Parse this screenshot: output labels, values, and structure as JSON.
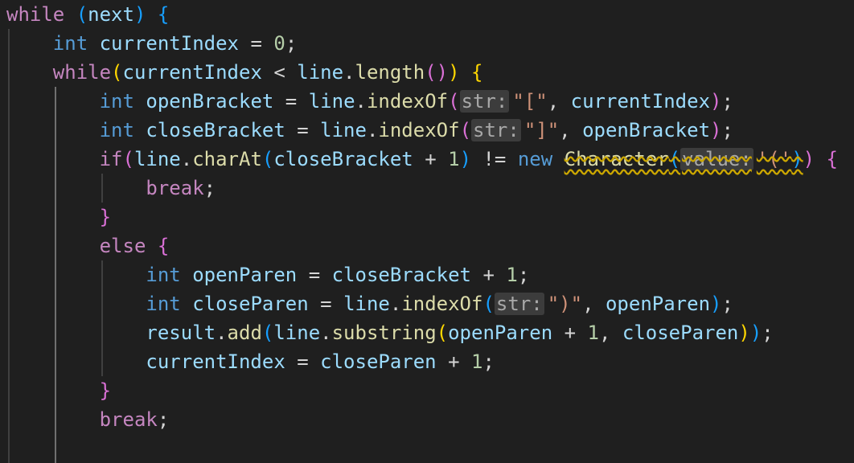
{
  "editor": {
    "language": "java",
    "colors": {
      "background": "#1f1f1f",
      "keyword": "#c586c0",
      "type": "#569cd6",
      "variable": "#9cdcfe",
      "function": "#dcdcaa",
      "number": "#b5cea8",
      "string": "#ce9178",
      "warning_squiggle": "#cca700",
      "bracket_level_1": "#ffd700",
      "bracket_level_2": "#da70d6",
      "bracket_level_3": "#179fff"
    },
    "lines": [
      {
        "indent": 0,
        "tokens": [
          {
            "t": "while",
            "c": "kw"
          },
          {
            "t": " "
          },
          {
            "t": "(",
            "c": "br3"
          },
          {
            "t": "next",
            "c": "var"
          },
          {
            "t": ")",
            "c": "br3"
          },
          {
            "t": " "
          },
          {
            "t": "{",
            "c": "br3"
          }
        ]
      },
      {
        "indent": 1,
        "tokens": [
          {
            "t": "int",
            "c": "type"
          },
          {
            "t": " "
          },
          {
            "t": "currentIndex",
            "c": "var"
          },
          {
            "t": " = "
          },
          {
            "t": "0",
            "c": "num"
          },
          {
            "t": ";"
          }
        ]
      },
      {
        "indent": 1,
        "tokens": [
          {
            "t": "while",
            "c": "kw"
          },
          {
            "t": "(",
            "c": "br1"
          },
          {
            "t": "currentIndex",
            "c": "var"
          },
          {
            "t": " < "
          },
          {
            "t": "line",
            "c": "var"
          },
          {
            "t": "."
          },
          {
            "t": "length",
            "c": "fn"
          },
          {
            "t": "()",
            "c": "br2"
          },
          {
            "t": ")",
            "c": "br1"
          },
          {
            "t": " "
          },
          {
            "t": "{",
            "c": "br1"
          }
        ]
      },
      {
        "indent": 2,
        "tokens": [
          {
            "t": "int",
            "c": "type"
          },
          {
            "t": " "
          },
          {
            "t": "openBracket",
            "c": "var"
          },
          {
            "t": " = "
          },
          {
            "t": "line",
            "c": "var"
          },
          {
            "t": "."
          },
          {
            "t": "indexOf",
            "c": "fn"
          },
          {
            "t": "(",
            "c": "br2"
          },
          {
            "t": "str:",
            "c": "hint"
          },
          {
            "t": "\"[\"",
            "c": "str"
          },
          {
            "t": ", "
          },
          {
            "t": "currentIndex",
            "c": "var"
          },
          {
            "t": ")",
            "c": "br2"
          },
          {
            "t": ";"
          }
        ]
      },
      {
        "indent": 2,
        "tokens": [
          {
            "t": "int",
            "c": "type"
          },
          {
            "t": " "
          },
          {
            "t": "closeBracket",
            "c": "var"
          },
          {
            "t": " = "
          },
          {
            "t": "line",
            "c": "var"
          },
          {
            "t": "."
          },
          {
            "t": "indexOf",
            "c": "fn"
          },
          {
            "t": "(",
            "c": "br2"
          },
          {
            "t": "str:",
            "c": "hint"
          },
          {
            "t": "\"]\"",
            "c": "str"
          },
          {
            "t": ", "
          },
          {
            "t": "openBracket",
            "c": "var"
          },
          {
            "t": ")",
            "c": "br2"
          },
          {
            "t": ";"
          }
        ]
      },
      {
        "indent": 2,
        "tokens": [
          {
            "t": "if",
            "c": "kw"
          },
          {
            "t": "(",
            "c": "br2"
          },
          {
            "t": "line",
            "c": "var"
          },
          {
            "t": "."
          },
          {
            "t": "charAt",
            "c": "fn"
          },
          {
            "t": "(",
            "c": "br3"
          },
          {
            "t": "closeBracket",
            "c": "var"
          },
          {
            "t": " + "
          },
          {
            "t": "1",
            "c": "num"
          },
          {
            "t": ")",
            "c": "br3"
          },
          {
            "t": " != "
          },
          {
            "t": "new",
            "c": "type"
          },
          {
            "t": " "
          },
          {
            "t": "Character",
            "c": "fn warn"
          },
          {
            "t": "(",
            "c": "br3 warn"
          },
          {
            "t": "value:",
            "c": "hint warn"
          },
          {
            "t": "'('",
            "c": "str warn"
          },
          {
            "t": ")",
            "c": "br3 warn"
          },
          {
            "t": ")",
            "c": "br2"
          },
          {
            "t": " "
          },
          {
            "t": "{",
            "c": "br2"
          }
        ]
      },
      {
        "indent": 3,
        "tokens": [
          {
            "t": "break",
            "c": "kw"
          },
          {
            "t": ";"
          }
        ]
      },
      {
        "indent": 2,
        "tokens": [
          {
            "t": "}",
            "c": "br2"
          }
        ]
      },
      {
        "indent": 2,
        "tokens": [
          {
            "t": "else",
            "c": "kw"
          },
          {
            "t": " "
          },
          {
            "t": "{",
            "c": "br2"
          }
        ]
      },
      {
        "indent": 3,
        "tokens": [
          {
            "t": "int",
            "c": "type"
          },
          {
            "t": " "
          },
          {
            "t": "openParen",
            "c": "var"
          },
          {
            "t": " = "
          },
          {
            "t": "closeBracket",
            "c": "var"
          },
          {
            "t": " + "
          },
          {
            "t": "1",
            "c": "num"
          },
          {
            "t": ";"
          }
        ]
      },
      {
        "indent": 3,
        "tokens": [
          {
            "t": "int",
            "c": "type"
          },
          {
            "t": " "
          },
          {
            "t": "closeParen",
            "c": "var"
          },
          {
            "t": " = "
          },
          {
            "t": "line",
            "c": "var"
          },
          {
            "t": "."
          },
          {
            "t": "indexOf",
            "c": "fn"
          },
          {
            "t": "(",
            "c": "br3"
          },
          {
            "t": "str:",
            "c": "hint"
          },
          {
            "t": "\")\"",
            "c": "str"
          },
          {
            "t": ", "
          },
          {
            "t": "openParen",
            "c": "var"
          },
          {
            "t": ")",
            "c": "br3"
          },
          {
            "t": ";"
          }
        ]
      },
      {
        "indent": 3,
        "tokens": [
          {
            "t": "result",
            "c": "var"
          },
          {
            "t": "."
          },
          {
            "t": "add",
            "c": "fn"
          },
          {
            "t": "(",
            "c": "br3"
          },
          {
            "t": "line",
            "c": "var"
          },
          {
            "t": "."
          },
          {
            "t": "substring",
            "c": "fn"
          },
          {
            "t": "(",
            "c": "br1"
          },
          {
            "t": "openParen",
            "c": "var"
          },
          {
            "t": " + "
          },
          {
            "t": "1",
            "c": "num"
          },
          {
            "t": ", "
          },
          {
            "t": "closeParen",
            "c": "var"
          },
          {
            "t": ")",
            "c": "br1"
          },
          {
            "t": ")",
            "c": "br3"
          },
          {
            "t": ";"
          }
        ]
      },
      {
        "indent": 3,
        "tokens": [
          {
            "t": "currentIndex",
            "c": "var"
          },
          {
            "t": " = "
          },
          {
            "t": "closeParen",
            "c": "var"
          },
          {
            "t": " + "
          },
          {
            "t": "1",
            "c": "num"
          },
          {
            "t": ";"
          }
        ]
      },
      {
        "indent": 2,
        "tokens": [
          {
            "t": "}",
            "c": "br2"
          }
        ]
      },
      {
        "indent": 2,
        "tokens": [
          {
            "t": "break",
            "c": "kw"
          },
          {
            "t": ";"
          }
        ]
      },
      {
        "indent": 2,
        "tokens": []
      }
    ]
  }
}
